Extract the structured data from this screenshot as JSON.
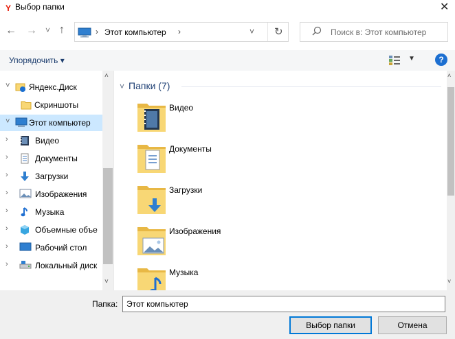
{
  "window": {
    "title": "Выбор папки",
    "close_glyph": "✕",
    "logo_icon": "yandex-browser-logo"
  },
  "nav": {
    "back_glyph": "←",
    "forward_glyph": "→",
    "recent_glyph": "˅",
    "up_glyph": "↑",
    "address": {
      "location": "Этот компьютер",
      "separator": "›",
      "dropdown_glyph": "˅",
      "refresh_glyph": "↻"
    },
    "search": {
      "placeholder": "Поиск в: Этот компьютер"
    }
  },
  "toolbar": {
    "organize_label": "Упорядочить ▾",
    "view_dropdown_glyph": "▼",
    "help_label": "?"
  },
  "tree": {
    "items": [
      {
        "label": "Яндекс.Диск",
        "chevron": "˅",
        "icon": "yandex-disk-icon"
      },
      {
        "label": "Скриншоты",
        "chevron": "",
        "icon": "folder-icon"
      },
      {
        "label": "Этот компьютер",
        "chevron": "˅",
        "icon": "computer-icon",
        "selected": true
      },
      {
        "label": "Видео",
        "chevron": "›",
        "icon": "video-icon"
      },
      {
        "label": "Документы",
        "chevron": "›",
        "icon": "documents-icon"
      },
      {
        "label": "Загрузки",
        "chevron": "›",
        "icon": "downloads-icon"
      },
      {
        "label": "Изображения",
        "chevron": "›",
        "icon": "pictures-icon"
      },
      {
        "label": "Музыка",
        "chevron": "›",
        "icon": "music-icon"
      },
      {
        "label": "Объемные объе",
        "chevron": "›",
        "icon": "3d-objects-icon"
      },
      {
        "label": "Рабочий стол",
        "chevron": "›",
        "icon": "desktop-icon"
      },
      {
        "label": "Локальный диск",
        "chevron": "›",
        "icon": "local-disk-icon"
      }
    ],
    "scroll_up": "˄",
    "scroll_down": "˅"
  },
  "content": {
    "group_header": "Папки (7)",
    "group_chevron": "˅",
    "folders": [
      {
        "label": "Видео",
        "icon": "video-folder-icon"
      },
      {
        "label": "Документы",
        "icon": "documents-folder-icon"
      },
      {
        "label": "Загрузки",
        "icon": "downloads-folder-icon"
      },
      {
        "label": "Изображения",
        "icon": "pictures-folder-icon"
      },
      {
        "label": "Музыка",
        "icon": "music-folder-icon"
      }
    ],
    "scroll_up": "˄",
    "scroll_down": "˅"
  },
  "footer": {
    "folder_label": "Папка:",
    "folder_value": "Этот компьютер",
    "ok_label": "Выбор папки",
    "cancel_label": "Отмена"
  },
  "colors": {
    "accent": "#0078d7",
    "selection": "#cce8ff",
    "header_blue": "#1e3f74",
    "folder_yellow": "#f8d775"
  }
}
